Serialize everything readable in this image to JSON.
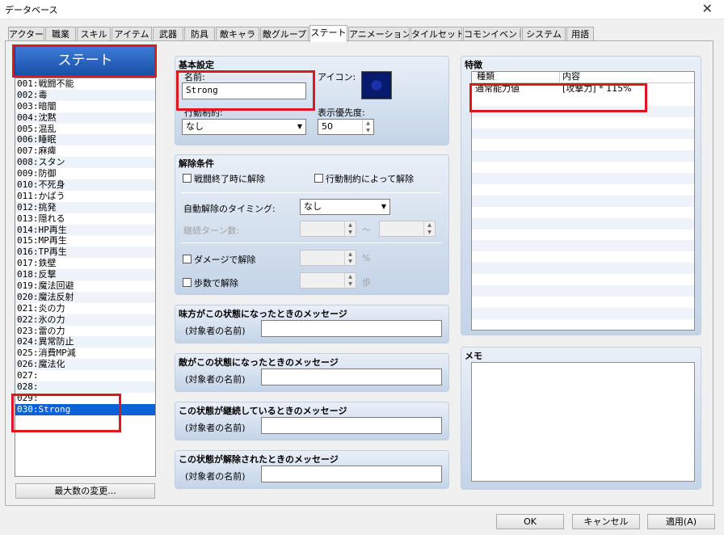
{
  "window": {
    "title": "データベース",
    "close_glyph": "✕"
  },
  "tabs": [
    "アクター",
    "職業",
    "スキル",
    "アイテム",
    "武器",
    "防具",
    "敵キャラ",
    "敵グループ",
    "ステート",
    "アニメーション",
    "タイルセット",
    "コモンイベント",
    "システム",
    "用語"
  ],
  "active_tab": "ステート",
  "list": {
    "header": "ステート",
    "items": [
      "001:戦闘不能",
      "002:毒",
      "003:暗闇",
      "004:沈黙",
      "005:混乱",
      "006:睡眠",
      "007:麻痺",
      "008:スタン",
      "009:防御",
      "010:不死身",
      "011:かばう",
      "012:挑発",
      "013:隠れる",
      "014:HP再生",
      "015:MP再生",
      "016:TP再生",
      "017:鉄壁",
      "018:反撃",
      "019:魔法回避",
      "020:魔法反射",
      "021:炎の力",
      "022:氷の力",
      "023:雷の力",
      "024:異常防止",
      "025:消費MP減",
      "026:魔法化",
      "027:",
      "028:",
      "029:",
      "030:Strong"
    ],
    "selected": "030:Strong",
    "max_button": "最大数の変更..."
  },
  "basic": {
    "title": "基本設定",
    "name_label": "名前:",
    "name_value": "Strong",
    "icon_label": "アイコン:",
    "restriction_label": "行動制約:",
    "restriction_value": "なし",
    "priority_label": "表示優先度:",
    "priority_value": "50"
  },
  "removal": {
    "title": "解除条件",
    "battle_end": "戦闘終了時に解除",
    "by_restriction": "行動制約によって解除",
    "auto_timing_label": "自動解除のタイミング:",
    "auto_timing_value": "なし",
    "duration_label": "継続ターン数:",
    "tilde": "〜",
    "damage_label": "ダメージで解除",
    "percent": "%",
    "steps_label": "歩数で解除",
    "steps_unit": "歩"
  },
  "messages": [
    {
      "title": "味方がこの状態になったときのメッセージ",
      "label": "(対象者の名前)"
    },
    {
      "title": "敵がこの状態になったときのメッセージ",
      "label": "(対象者の名前)"
    },
    {
      "title": "この状態が継続しているときのメッセージ",
      "label": "(対象者の名前)"
    },
    {
      "title": "この状態が解除されたときのメッセージ",
      "label": "(対象者の名前)"
    }
  ],
  "traits": {
    "title": "特徴",
    "col_type": "種類",
    "col_content": "内容",
    "rows": [
      {
        "type": "通常能力値",
        "content": "[攻撃力] * 115%"
      }
    ]
  },
  "memo": {
    "title": "メモ"
  },
  "buttons": {
    "ok": "OK",
    "cancel": "キャンセル",
    "apply": "適用(A)"
  },
  "colors": {
    "highlight_red": "#e0161e",
    "selection_blue": "#0a62d6",
    "header_blue": "#1a4fa8"
  }
}
